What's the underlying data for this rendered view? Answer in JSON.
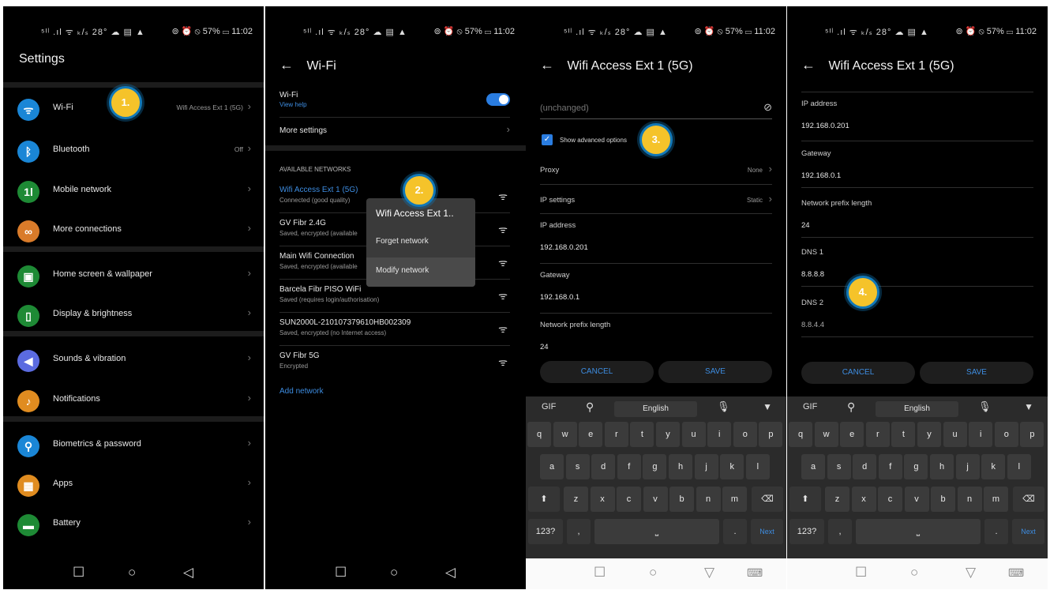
{
  "status": {
    "left": "⁵ᴵˡ .ıl ᯤ ₖ/ₛ 28° ☁ ▤ ▲",
    "right": "⊚ ⏰ ⦸ 57% ▭ 11:02"
  },
  "p1": {
    "title": "Settings",
    "items": [
      {
        "label": "Wi-Fi",
        "value": "Wifi Access Ext 1 (5G)",
        "icon": "wifi-icon",
        "color": "#1a86d6"
      },
      {
        "label": "Bluetooth",
        "value": "Off",
        "icon": "bluetooth-icon",
        "color": "#1a86d6"
      },
      {
        "label": "Mobile network",
        "value": "",
        "icon": "mobile-network-icon",
        "color": "#1e8a35"
      },
      {
        "label": "More connections",
        "value": "",
        "icon": "link-icon",
        "color": "#d97b2a"
      },
      {
        "label": "Home screen & wallpaper",
        "value": "",
        "icon": "wallpaper-icon",
        "color": "#1e8a35"
      },
      {
        "label": "Display & brightness",
        "value": "",
        "icon": "display-icon",
        "color": "#1e8a35"
      },
      {
        "label": "Sounds & vibration",
        "value": "",
        "icon": "sound-icon",
        "color": "#5b6be0"
      },
      {
        "label": "Notifications",
        "value": "",
        "icon": "bell-icon",
        "color": "#e08c20"
      },
      {
        "label": "Biometrics & password",
        "value": "",
        "icon": "key-icon",
        "color": "#1a86d6"
      },
      {
        "label": "Apps",
        "value": "",
        "icon": "apps-icon",
        "color": "#e08c20"
      },
      {
        "label": "Battery",
        "value": "",
        "icon": "battery-icon",
        "color": "#1e8a35"
      }
    ]
  },
  "p2": {
    "title": "Wi-Fi",
    "wifi_label": "Wi-Fi",
    "view_help": "View help",
    "more_settings": "More settings",
    "available": "AVAILABLE NETWORKS",
    "networks": [
      {
        "name": "Wifi Access Ext 1 (5G)",
        "status": "Connected (good quality)"
      },
      {
        "name": "GV Fibr 2.4G",
        "status": "Saved, encrypted (available"
      },
      {
        "name": "Main Wifi Connection",
        "status": "Saved, encrypted (available"
      },
      {
        "name": "Barcela Fibr PISO WiFi",
        "status": "Saved (requires login/authorisation)"
      },
      {
        "name": "SUN2000L-210107379610HB002309",
        "status": "Saved, encrypted (no Internet access)"
      },
      {
        "name": "GV Fibr 5G",
        "status": "Encrypted"
      }
    ],
    "add_network": "Add network",
    "menu": {
      "title": "Wifi Access Ext 1..",
      "forget": "Forget network",
      "modify": "Modify network"
    }
  },
  "p3": {
    "title": "Wifi Access Ext 1 (5G)",
    "password_placeholder": "(unchanged)",
    "advanced": "Show advanced options",
    "proxy": "Proxy",
    "proxy_val": "None",
    "ip_settings": "IP settings",
    "ip_settings_val": "Static",
    "ip_label": "IP address",
    "ip": "192.168.0.201",
    "gw_label": "Gateway",
    "gw": "192.168.0.1",
    "prefix_label": "Network prefix length",
    "prefix": "24"
  },
  "p4": {
    "title": "Wifi Access Ext 1 (5G)",
    "ip_label": "IP address",
    "ip": "192.168.0.201",
    "gw_label": "Gateway",
    "gw": "192.168.0.1",
    "prefix_label": "Network prefix length",
    "prefix": "24",
    "dns1_label": "DNS 1",
    "dns1": "8.8.8.8",
    "dns2_label": "DNS 2",
    "dns2": "8.8.4.4"
  },
  "buttons": {
    "cancel": "CANCEL",
    "save": "SAVE"
  },
  "keyboard": {
    "lang": "English",
    "row1": [
      "q",
      "w",
      "e",
      "r",
      "t",
      "y",
      "u",
      "i",
      "o",
      "p"
    ],
    "row2": [
      "a",
      "s",
      "d",
      "f",
      "g",
      "h",
      "j",
      "k",
      "l"
    ],
    "row3": [
      "z",
      "x",
      "c",
      "v",
      "b",
      "n",
      "m"
    ],
    "num": "123?",
    "comma": ",",
    "dot": ".",
    "next": "Next"
  },
  "badges": [
    "1.",
    "2.",
    "3.",
    "4."
  ]
}
